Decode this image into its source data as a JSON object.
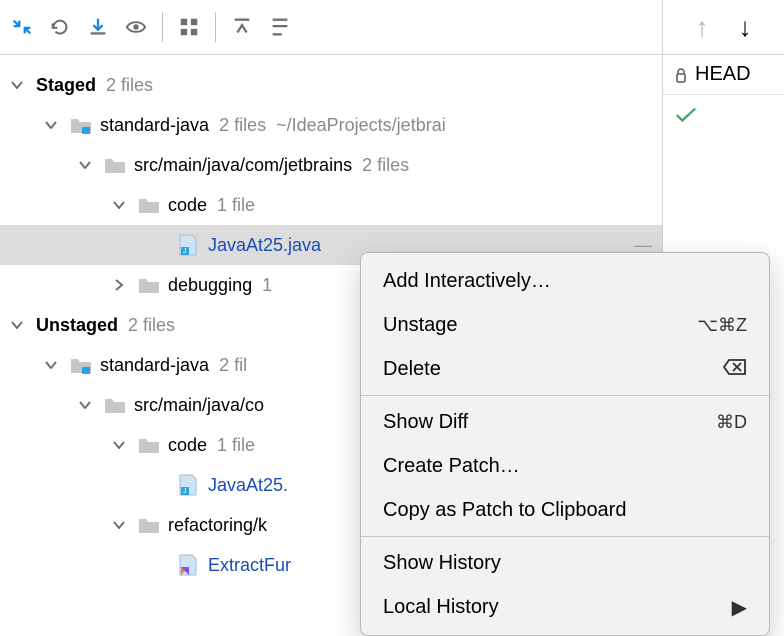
{
  "toolbar_icons": [
    "collapse",
    "refresh",
    "download",
    "eye",
    "group",
    "expand-all",
    "collapse-all"
  ],
  "right": {
    "up": "↑",
    "down": "↓",
    "lock": "🔒",
    "head": "HEAD"
  },
  "staged": {
    "title": "Staged",
    "count": "2 files",
    "project": "standard-java",
    "project_count": "2 files",
    "project_path": "~/IdeaProjects/jetbrai",
    "src": "src/main/java/com/jetbrains",
    "src_count": "2 files",
    "code": "code",
    "code_count": "1 file",
    "file": "JavaAt25.java",
    "debugging": "debugging",
    "debugging_count": "1"
  },
  "unstaged": {
    "title": "Unstaged",
    "count": "2 files",
    "project": "standard-java",
    "project_count": "2 fil",
    "src": "src/main/java/co",
    "code": "code",
    "code_count": "1 file",
    "file": "JavaAt25.",
    "refactoring": "refactoring/k",
    "extract": "ExtractFur"
  },
  "menu": {
    "add": "Add Interactively…",
    "unstage": "Unstage",
    "unstage_sc": "⌥⌘Z",
    "delete": "Delete",
    "diff": "Show Diff",
    "diff_sc": "⌘D",
    "patch": "Create Patch…",
    "copy": "Copy as Patch to Clipboard",
    "hist": "Show History",
    "local": "Local History"
  }
}
